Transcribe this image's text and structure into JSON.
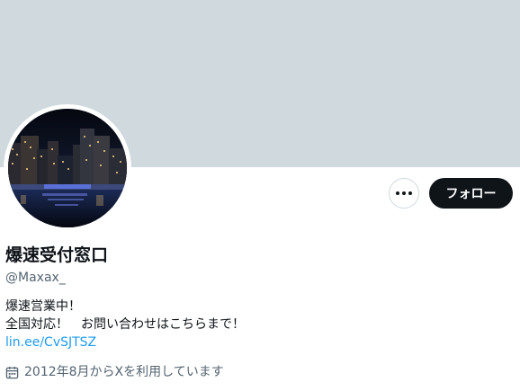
{
  "profile": {
    "display_name": "爆速受付窓口",
    "handle": "@Maxax_",
    "bio_lines": [
      "爆速営業中！",
      "全国対応！　お問い合わせはこちらまで！"
    ],
    "bio_link": "lin.ee/CvSJTSZ",
    "joined": "2012年8月からXを利用しています"
  },
  "actions": {
    "more_icon": "more-horizontal-icon",
    "follow_label": "フォロー"
  },
  "colors": {
    "banner": "#cfd9de",
    "follow_bg": "#0f1419",
    "link": "#1d9bf0",
    "secondary_text": "#536471"
  },
  "icons": {
    "joined": "calendar-icon"
  }
}
